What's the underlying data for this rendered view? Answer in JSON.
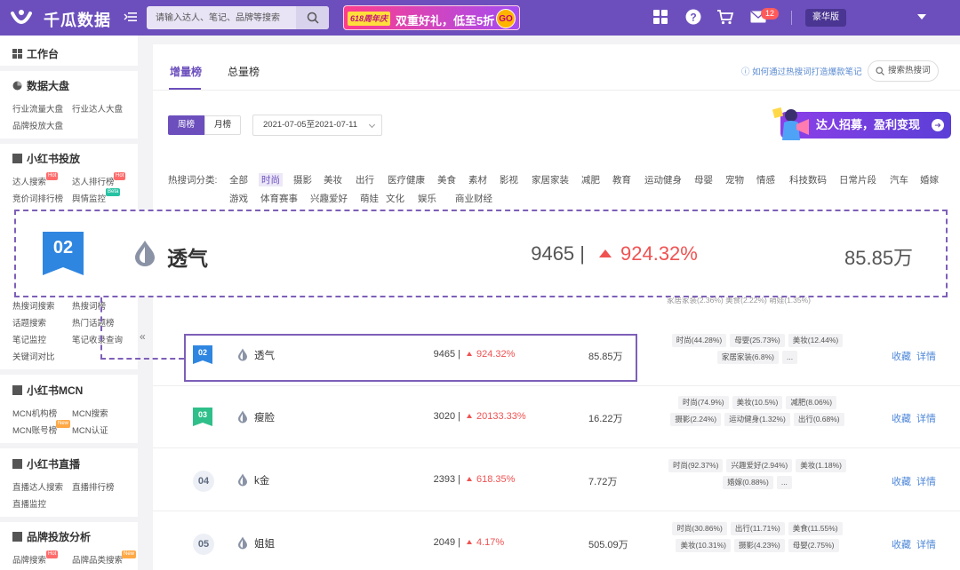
{
  "header": {
    "brand": "千瓜数据",
    "search_placeholder": "请输入达人、笔记、品牌等搜索",
    "promo_tag": "618周年庆",
    "promo_text": "双重好礼，低至5折",
    "promo_go": "GO",
    "mail_badge": "12",
    "edition": "豪华版",
    "accent_color": "#6c4fbd"
  },
  "sidebar": {
    "workbench": "工作台",
    "data_dashboard": {
      "title": "数据大盘",
      "items": [
        "行业流量大盘",
        "行业达人大盘",
        "品牌投放大盘"
      ]
    },
    "xhs_ads": {
      "title": "小红书投放",
      "items": [
        "达人搜索",
        "达人排行榜",
        "竞价词排行榜",
        "舆情监控"
      ],
      "tags": [
        "Hot",
        "Hot",
        "Beta"
      ]
    },
    "keywords_clipped": [
      "热搜词搜索",
      "热搜词榜",
      "话题搜索",
      "热门话题榜",
      "笔记监控",
      "笔记收录查询",
      "关键词对比"
    ],
    "mcn": {
      "title": "小红书MCN",
      "items": [
        "MCN机构榜",
        "MCN搜索",
        "MCN账号榜",
        "MCN认证"
      ],
      "tag": "New"
    },
    "live": {
      "title": "小红书直播",
      "items": [
        "直播达人搜索",
        "直播排行榜",
        "直播监控"
      ]
    },
    "brand_analysis": {
      "title": "品牌投放分析",
      "items": [
        "品牌搜索",
        "品牌品类搜索"
      ],
      "tags": [
        "Hot",
        "New"
      ]
    },
    "collapse": "«"
  },
  "main": {
    "tabs": [
      "增量榜",
      "总量榜"
    ],
    "howto_link": "如何通过热搜词打造爆款笔记",
    "hot_search_btn": "搜索热搜词",
    "period": [
      "周榜",
      "月榜"
    ],
    "date_range": "2021-07-05至2021-07-11",
    "recruit_banner": "达人招募，盈利变现",
    "category_label": "热搜词分类:",
    "categories_row1": [
      "全部",
      "时尚",
      "摄影",
      "美妆",
      "出行",
      "医疗健康",
      "美食",
      "素材",
      "影视",
      "家居家装",
      "减肥",
      "教育",
      "运动健身",
      "母婴",
      "宠物",
      "情感",
      "科技数码",
      "日常片段",
      "汽车",
      "婚嫁"
    ],
    "categories_row2": [
      "游戏",
      "体育赛事",
      "兴趣爱好",
      "萌娃",
      "文化",
      "娱乐",
      "商业财经"
    ],
    "active_category": "时尚",
    "clipped_tags": "家居家装(2.36%)   美食(2.22%)   萌娃(1.35%)",
    "rows": [
      {
        "rank": "02",
        "keyword": "透气",
        "count": "9465 |",
        "growth": "924.32%",
        "notes": "85.85万",
        "tags": [
          "时尚(44.28%)",
          "母婴(25.73%)",
          "美妆(12.44%)",
          "家居家装(6.8%)",
          "..."
        ],
        "fav": "收藏",
        "detail": "详情"
      },
      {
        "rank": "03",
        "keyword": "瘦脸",
        "count": "3020 |",
        "growth": "20133.33%",
        "notes": "16.22万",
        "tags": [
          "时尚(74.9%)",
          "美妆(10.5%)",
          "减肥(8.06%)",
          "摄影(2.24%)",
          "运动健身(1.32%)",
          "出行(0.68%)"
        ],
        "fav": "收藏",
        "detail": "详情"
      },
      {
        "rank": "04",
        "keyword": "k金",
        "count": "2393 |",
        "growth": "618.35%",
        "notes": "7.72万",
        "tags": [
          "时尚(92.37%)",
          "兴趣爱好(2.94%)",
          "美妆(1.18%)",
          "婚嫁(0.88%)",
          "..."
        ],
        "fav": "收藏",
        "detail": "详情"
      },
      {
        "rank": "05",
        "keyword": "姐姐",
        "count": "2049 |",
        "growth": "4.17%",
        "notes": "505.09万",
        "tags": [
          "时尚(30.86%)",
          "出行(11.71%)",
          "美食(11.55%)",
          "美妆(10.31%)",
          "摄影(4.23%)",
          "母婴(2.75%)"
        ],
        "fav": "收藏",
        "detail": "详情"
      }
    ]
  },
  "magnified": {
    "rank": "02",
    "keyword": "透气",
    "count": "9465 |",
    "growth": "924.32%",
    "notes": "85.85万"
  }
}
